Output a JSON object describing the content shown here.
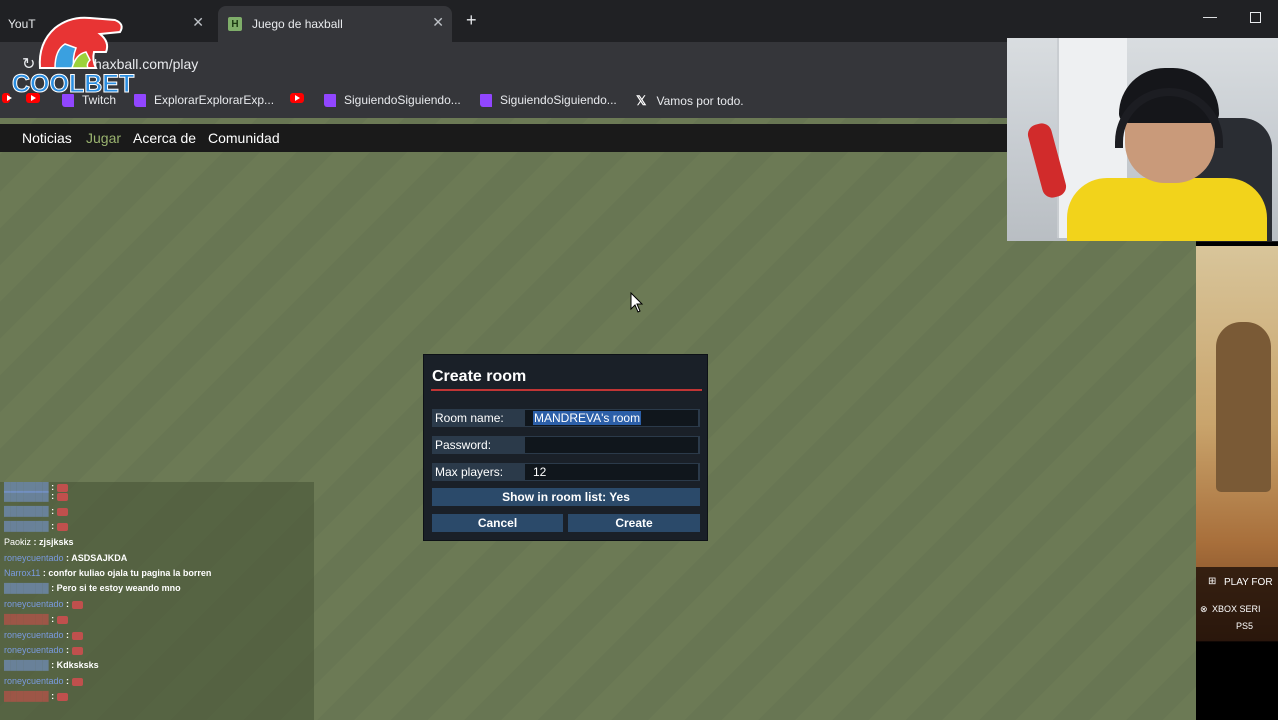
{
  "browser": {
    "tabs": [
      {
        "label": "YouT",
        "active": false
      },
      {
        "label": "Juego de haxball",
        "active": true
      }
    ],
    "url": "haxball.com/play",
    "bookmarks": [
      {
        "label": "Twitch",
        "icon": "twitch-icon"
      },
      {
        "label": "ExplorarExplorarExp...",
        "icon": "twitch-icon"
      },
      {
        "label": "SiguiendoSiguiendo...",
        "icon": "twitch-icon"
      },
      {
        "label": "SiguiendoSiguiendo...",
        "icon": "twitch-icon"
      },
      {
        "label": "Vamos por todo.",
        "icon": "x-icon"
      }
    ]
  },
  "nav": {
    "items": [
      "Noticias",
      "Jugar",
      "Acerca de",
      "Comunidad"
    ],
    "active": "Jugar"
  },
  "dialog": {
    "title": "Create room",
    "room_name_label": "Room name:",
    "room_name_value": "MANDREVA's room",
    "password_label": "Password:",
    "password_value": "",
    "max_players_label": "Max players:",
    "max_players_value": "12",
    "show_in_list": "Show in room list: Yes",
    "cancel": "Cancel",
    "create": "Create"
  },
  "chat": [
    {
      "name": "",
      "text": ""
    },
    {
      "name": "",
      "text": ""
    },
    {
      "name": "",
      "text": ""
    },
    {
      "name": "",
      "text": ""
    },
    {
      "name": "Paokiz",
      "text": "zjsjksks"
    },
    {
      "name": "roneycuentado",
      "text": "ASDSAJKDA"
    },
    {
      "name": "Narrox11",
      "text": "confor kuliao ojala tu pagina la borren"
    },
    {
      "name": "",
      "text": "Pero si te estoy weando mno"
    },
    {
      "name": "roneycuentado",
      "text": ""
    },
    {
      "name": "",
      "text": ""
    },
    {
      "name": "roneycuentado",
      "text": ""
    },
    {
      "name": "roneycuentado",
      "text": ""
    },
    {
      "name": "",
      "text": "Kdksksks"
    },
    {
      "name": "roneycuentado",
      "text": ""
    },
    {
      "name": "",
      "text": ""
    }
  ],
  "overlay": {
    "logo": "COOLBET",
    "ad_texts": [
      "PLAY FOR",
      "XBOX SERI",
      "PS5"
    ]
  }
}
